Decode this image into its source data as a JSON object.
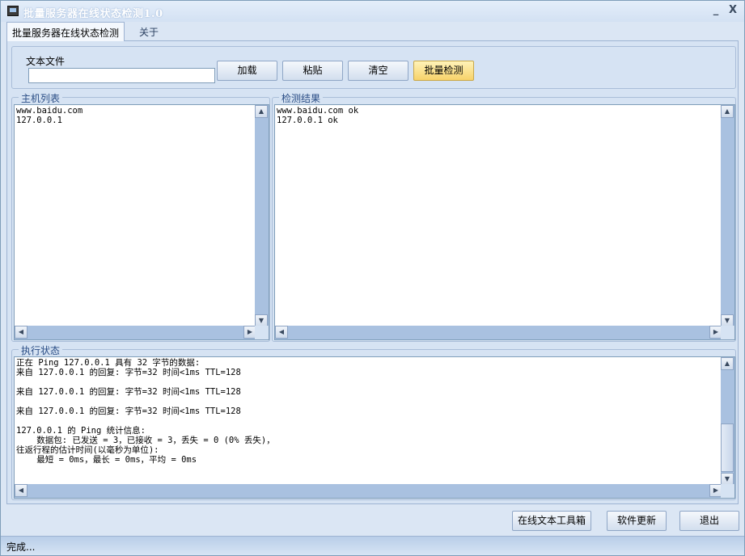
{
  "window": {
    "title": "批量服务器在线状态检测1.0",
    "minimize_glyph": "_",
    "close_glyph": "X"
  },
  "tabs": [
    {
      "label": "批量服务器在线状态检测",
      "active": true
    },
    {
      "label": "关于",
      "active": false
    }
  ],
  "file_section": {
    "label": "文本文件",
    "input_value": "",
    "buttons": {
      "load": "加载",
      "paste": "粘贴",
      "clear": "清空",
      "batch_check": "批量检测"
    }
  },
  "host_list": {
    "label": "主机列表",
    "text": "www.baidu.com\n127.0.0.1"
  },
  "results": {
    "label": "检测结果",
    "text": "www.baidu.com ok\n127.0.0.1 ok"
  },
  "exec_status": {
    "label": "执行状态",
    "text": "正在 Ping 127.0.0.1 具有 32 字节的数据:\n来自 127.0.0.1 的回复: 字节=32 时间<1ms TTL=128\n\n来自 127.0.0.1 的回复: 字节=32 时间<1ms TTL=128\n\n来自 127.0.0.1 的回复: 字节=32 时间<1ms TTL=128\n\n127.0.0.1 的 Ping 统计信息:\n    数据包: 已发送 = 3，已接收 = 3，丢失 = 0 (0% 丢失)，\n往返行程的估计时间(以毫秒为单位):\n    最短 = 0ms，最长 = 0ms，平均 = 0ms"
  },
  "bottom_buttons": {
    "toolbox": "在线文本工具箱",
    "update": "软件更新",
    "exit": "退出"
  },
  "status_bar": {
    "text": "完成..."
  },
  "colors": {
    "window_bg": "#dbe6f4",
    "accent_button": "#f7d26a",
    "scrollbar": "#a9c1e0",
    "group_label": "#2a4d85"
  },
  "icons": {
    "scroll_up": "▲",
    "scroll_down": "▼",
    "scroll_left": "◀",
    "scroll_right": "▶"
  }
}
